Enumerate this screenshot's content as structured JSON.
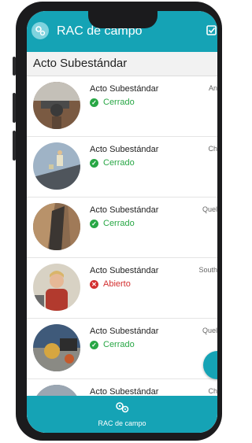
{
  "app": {
    "title": "RAC de campo"
  },
  "section": {
    "title": "Acto Subestándar"
  },
  "colors": {
    "accent": "#15a3b5",
    "closed": "#28a745",
    "open": "#d32f2f"
  },
  "items": [
    {
      "title": "Acto Subestándar",
      "status": "Cerrado",
      "state": "closed",
      "right": "An",
      "image": "industrial-pipes"
    },
    {
      "title": "Acto Subestándar",
      "status": "Cerrado",
      "state": "closed",
      "right": "Ch",
      "image": "worker-on-roof"
    },
    {
      "title": "Acto Subestándar",
      "status": "Cerrado",
      "state": "closed",
      "right": "Quel",
      "image": "rock-tunnel"
    },
    {
      "title": "Acto Subestándar",
      "status": "Abierto",
      "state": "open",
      "right": "South",
      "image": "worker-portrait"
    },
    {
      "title": "Acto Subestándar",
      "status": "Cerrado",
      "state": "closed",
      "right": "Quel",
      "image": "machinery"
    },
    {
      "title": "Acto Subestándar",
      "status": "",
      "state": "",
      "right": "Ch",
      "image": "partial"
    }
  ],
  "bottom_nav": {
    "label": "RAC de campo",
    "icon": "gears-icon"
  }
}
